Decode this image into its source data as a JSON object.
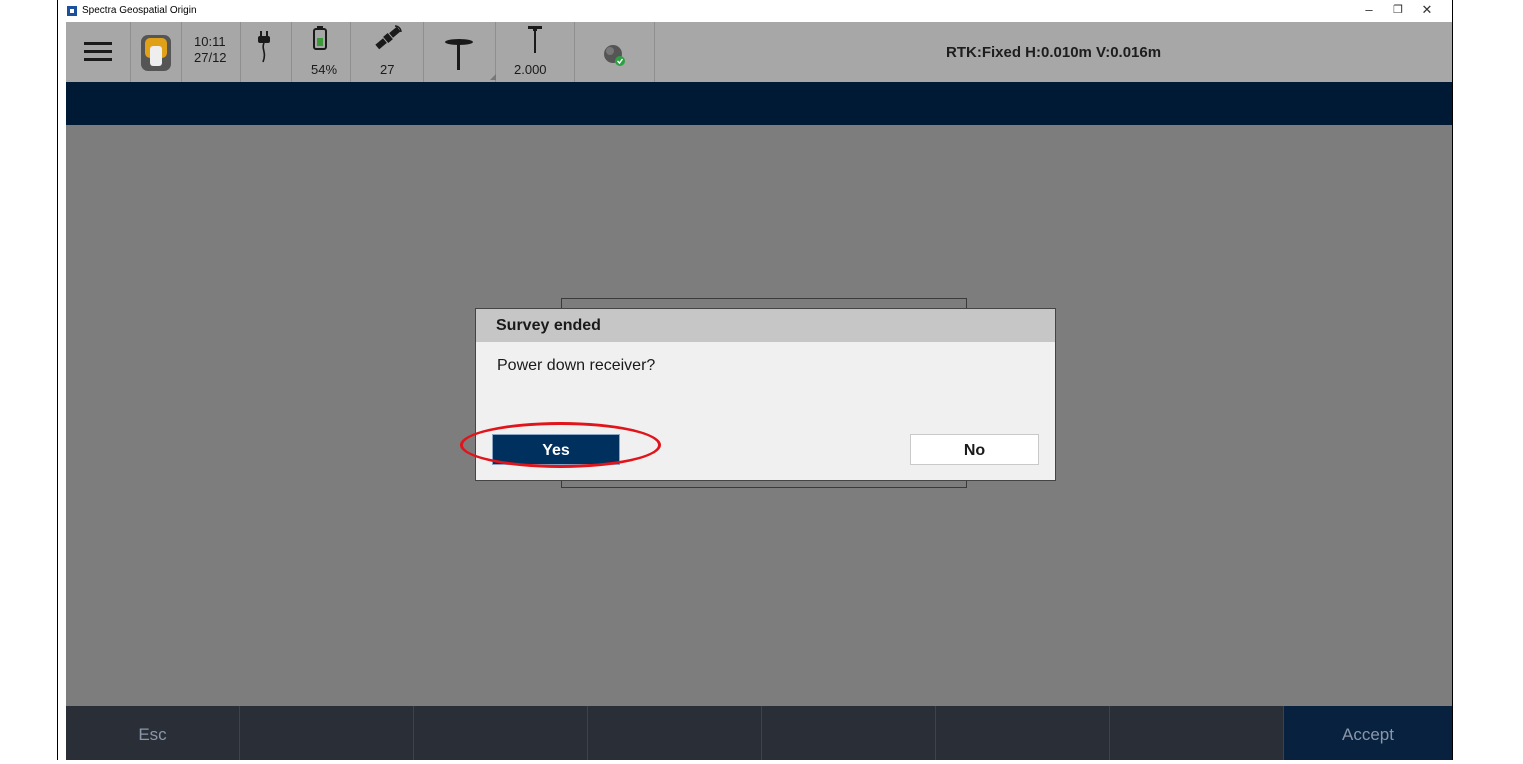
{
  "window": {
    "title": "Spectra Geospatial Origin",
    "controls": {
      "minimize": "–",
      "restore": "❐",
      "close": "✕"
    }
  },
  "toolbar": {
    "time": "10:11",
    "date": "27/12",
    "battery_percent": "54%",
    "satellites": "27",
    "antenna_height": "2.000",
    "status": "RTK:Fixed H:0.010m V:0.016m"
  },
  "dialog": {
    "title": "Survey ended",
    "message": "Power down receiver?",
    "yes_label": "Yes",
    "no_label": "No"
  },
  "softkeys": {
    "esc_label": "Esc",
    "accept_label": "Accept"
  },
  "colors": {
    "navbar": "#001a36",
    "workspace": "#7d7d7d",
    "primary_button": "#00305e",
    "highlight": "#e0141a"
  }
}
